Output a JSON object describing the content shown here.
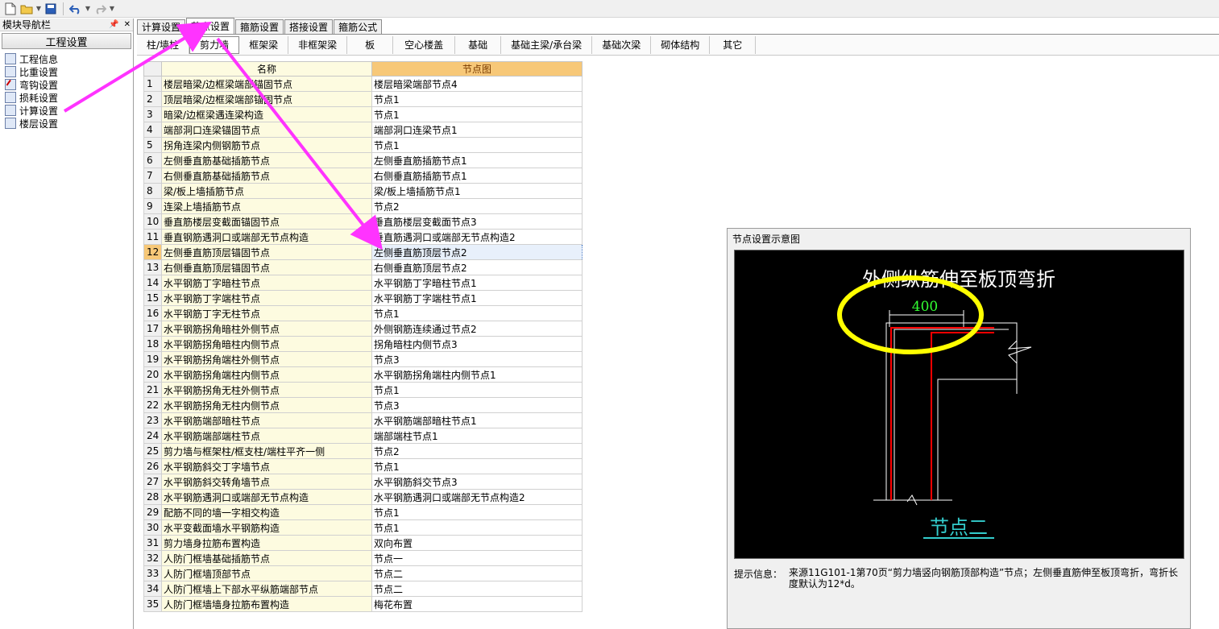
{
  "navigator": {
    "title": "模块导航栏",
    "pin_icon": "pin-icon",
    "close_icon": "close-icon",
    "section": "工程设置",
    "items": [
      {
        "label": "工程信息",
        "icon": "project-info-icon"
      },
      {
        "label": "比重设置",
        "icon": "density-icon"
      },
      {
        "label": "弯钩设置",
        "icon": "hook-icon"
      },
      {
        "label": "损耗设置",
        "icon": "loss-icon"
      },
      {
        "label": "计算设置",
        "icon": "calc-icon"
      },
      {
        "label": "楼层设置",
        "icon": "floor-icon"
      }
    ]
  },
  "tabs": [
    {
      "label": "计算设置",
      "active": false
    },
    {
      "label": "节点设置",
      "active": true
    },
    {
      "label": "箍筋设置",
      "active": false
    },
    {
      "label": "搭接设置",
      "active": false
    },
    {
      "label": "箍筋公式",
      "active": false
    }
  ],
  "subtabs": [
    {
      "label": "柱/墙柱",
      "active": false
    },
    {
      "label": "剪力墙",
      "active": true
    },
    {
      "label": "框架梁",
      "active": false
    },
    {
      "label": "非框架梁",
      "active": false
    },
    {
      "label": "板",
      "active": false
    },
    {
      "label": "空心楼盖",
      "active": false
    },
    {
      "label": "基础",
      "active": false
    },
    {
      "label": "基础主梁/承台梁",
      "active": false
    },
    {
      "label": "基础次梁",
      "active": false
    },
    {
      "label": "砌体结构",
      "active": false
    },
    {
      "label": "其它",
      "active": false
    }
  ],
  "grid": {
    "headers": {
      "name": "名称",
      "node": "节点图"
    },
    "selected_row": 12,
    "rows": [
      {
        "idx": "1",
        "name": "楼层暗梁/边框梁端部锚固节点",
        "node": "楼层暗梁端部节点4"
      },
      {
        "idx": "2",
        "name": "顶层暗梁/边框梁端部锚固节点",
        "node": "节点1"
      },
      {
        "idx": "3",
        "name": "暗梁/边框梁遇连梁构造",
        "node": "节点1"
      },
      {
        "idx": "4",
        "name": "端部洞口连梁锚固节点",
        "node": "端部洞口连梁节点1"
      },
      {
        "idx": "5",
        "name": "拐角连梁内侧钢筋节点",
        "node": "节点1"
      },
      {
        "idx": "6",
        "name": "左侧垂直筋基础插筋节点",
        "node": "左侧垂直筋插筋节点1"
      },
      {
        "idx": "7",
        "name": "右侧垂直筋基础插筋节点",
        "node": "右侧垂直筋插筋节点1"
      },
      {
        "idx": "8",
        "name": "梁/板上墙插筋节点",
        "node": "梁/板上墙插筋节点1"
      },
      {
        "idx": "9",
        "name": "连梁上墙插筋节点",
        "node": "节点2"
      },
      {
        "idx": "10",
        "name": "垂直筋楼层变截面锚固节点",
        "node": "垂直筋楼层变截面节点3"
      },
      {
        "idx": "11",
        "name": "垂直钢筋遇洞口或端部无节点构造",
        "node": "垂直筋遇洞口或端部无节点构造2"
      },
      {
        "idx": "12",
        "name": "左侧垂直筋顶层锚固节点",
        "node": "左侧垂直筋顶层节点2"
      },
      {
        "idx": "13",
        "name": "右侧垂直筋顶层锚固节点",
        "node": "右侧垂直筋顶层节点2"
      },
      {
        "idx": "14",
        "name": "水平钢筋丁字暗柱节点",
        "node": "水平钢筋丁字暗柱节点1"
      },
      {
        "idx": "15",
        "name": "水平钢筋丁字端柱节点",
        "node": "水平钢筋丁字端柱节点1"
      },
      {
        "idx": "16",
        "name": "水平钢筋丁字无柱节点",
        "node": "节点1"
      },
      {
        "idx": "17",
        "name": "水平钢筋拐角暗柱外侧节点",
        "node": "外侧钢筋连续通过节点2"
      },
      {
        "idx": "18",
        "name": "水平钢筋拐角暗柱内侧节点",
        "node": "拐角暗柱内侧节点3"
      },
      {
        "idx": "19",
        "name": "水平钢筋拐角端柱外侧节点",
        "node": "节点3"
      },
      {
        "idx": "20",
        "name": "水平钢筋拐角端柱内侧节点",
        "node": "水平钢筋拐角端柱内侧节点1"
      },
      {
        "idx": "21",
        "name": "水平钢筋拐角无柱外侧节点",
        "node": "节点1"
      },
      {
        "idx": "22",
        "name": "水平钢筋拐角无柱内侧节点",
        "node": "节点3"
      },
      {
        "idx": "23",
        "name": "水平钢筋端部暗柱节点",
        "node": "水平钢筋端部暗柱节点1"
      },
      {
        "idx": "24",
        "name": "水平钢筋端部端柱节点",
        "node": "端部端柱节点1"
      },
      {
        "idx": "25",
        "name": "剪力墙与框架柱/框支柱/端柱平齐一侧",
        "node": "节点2"
      },
      {
        "idx": "26",
        "name": "水平钢筋斜交丁字墙节点",
        "node": "节点1"
      },
      {
        "idx": "27",
        "name": "水平钢筋斜交转角墙节点",
        "node": "水平钢筋斜交节点3"
      },
      {
        "idx": "28",
        "name": "水平钢筋遇洞口或端部无节点构造",
        "node": "水平钢筋遇洞口或端部无节点构造2"
      },
      {
        "idx": "29",
        "name": "配筋不同的墙一字相交构造",
        "node": "节点1"
      },
      {
        "idx": "30",
        "name": "水平变截面墙水平钢筋构造",
        "node": "节点1"
      },
      {
        "idx": "31",
        "name": "剪力墙身拉筋布置构造",
        "node": "双向布置"
      },
      {
        "idx": "32",
        "name": "人防门框墙基础插筋节点",
        "node": "节点一"
      },
      {
        "idx": "33",
        "name": "人防门框墙顶部节点",
        "node": "节点二"
      },
      {
        "idx": "34",
        "name": "人防门框墙上下部水平纵筋端部节点",
        "node": "节点二"
      },
      {
        "idx": "35",
        "name": "人防门框墙墙身拉筋布置构造",
        "node": "梅花布置"
      }
    ]
  },
  "preview": {
    "title": "节点设置示意图",
    "diagram_title": "外侧纵筋伸至板顶弯折",
    "dimension": "400",
    "node_label": "节点二",
    "hint_label": "提示信息：",
    "hint_text": "来源11G101-1第70页“剪力墙竖向钢筋顶部构造”节点；左侧垂直筋伸至板顶弯折，弯折长度默认为12*d。"
  },
  "colors": {
    "annotation_arrow": "#ff33ff",
    "annotation_circle": "#ffff00",
    "rebar": "#ff0000",
    "dimension_text": "#33ff33",
    "node_label": "#33cccc",
    "header_node_bg": "#f7c878",
    "name_col_bg": "#fdfbe0"
  }
}
